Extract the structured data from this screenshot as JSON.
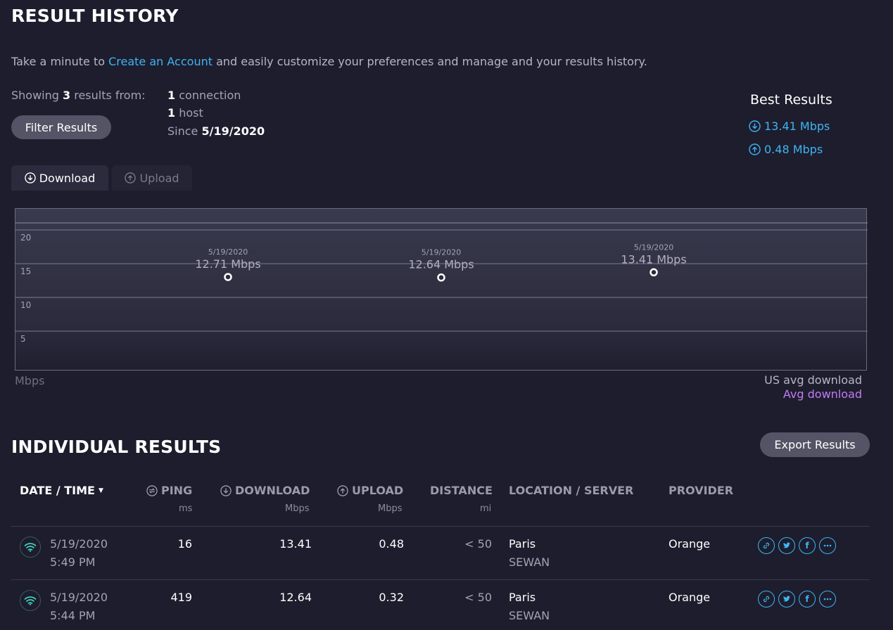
{
  "header": {
    "title": "RESULT HISTORY"
  },
  "intro": {
    "prefix": "Take a minute to ",
    "link": "Create an Account",
    "suffix": " and easily customize your preferences and manage and your results history."
  },
  "summary": {
    "showing_prefix": "Showing ",
    "count": "3",
    "showing_suffix": " results from:",
    "connection_count": "1",
    "connection_label": " connection",
    "host_count": "1",
    "host_label": " host",
    "since_label": "Since ",
    "since_date": "5/19/2020",
    "filter_button": "Filter Results"
  },
  "best": {
    "title": "Best Results",
    "download": "13.41 Mbps",
    "upload": "0.48 Mbps"
  },
  "tabs": [
    {
      "label": "Download",
      "icon": "download-icon",
      "active": true
    },
    {
      "label": "Upload",
      "icon": "upload-icon",
      "active": false
    }
  ],
  "chart_data": {
    "type": "line",
    "ylabel": "Mbps",
    "yticks": [
      20,
      15,
      10,
      5
    ],
    "ylim": [
      0,
      24
    ],
    "points": [
      {
        "date": "5/19/2020",
        "label": "12.71 Mbps",
        "value": 12.71
      },
      {
        "date": "5/19/2020",
        "label": "12.64 Mbps",
        "value": 12.64
      },
      {
        "date": "5/19/2020",
        "label": "13.41 Mbps",
        "value": 13.41
      }
    ],
    "legend": [
      "US avg download",
      "Avg download"
    ],
    "colors": {
      "us_avg": "#b6b6c6",
      "avg": "#c17cf2"
    }
  },
  "individual": {
    "title": "INDIVIDUAL RESULTS",
    "export_button": "Export Results",
    "columns": {
      "date": "DATE / TIME",
      "ping": "PING",
      "ping_unit": "ms",
      "download": "DOWNLOAD",
      "download_unit": "Mbps",
      "upload": "UPLOAD",
      "upload_unit": "Mbps",
      "distance": "DISTANCE",
      "distance_unit": "mi",
      "location": "LOCATION / SERVER",
      "provider": "PROVIDER"
    },
    "rows": [
      {
        "date": "5/19/2020",
        "time": "5:49 PM",
        "ping": "16",
        "download": "13.41",
        "upload": "0.48",
        "distance": "< 50",
        "location": "Paris",
        "server": "SEWAN",
        "provider": "Orange"
      },
      {
        "date": "5/19/2020",
        "time": "5:44 PM",
        "ping": "419",
        "download": "12.64",
        "upload": "0.32",
        "distance": "< 50",
        "location": "Paris",
        "server": "SEWAN",
        "provider": "Orange"
      }
    ]
  }
}
